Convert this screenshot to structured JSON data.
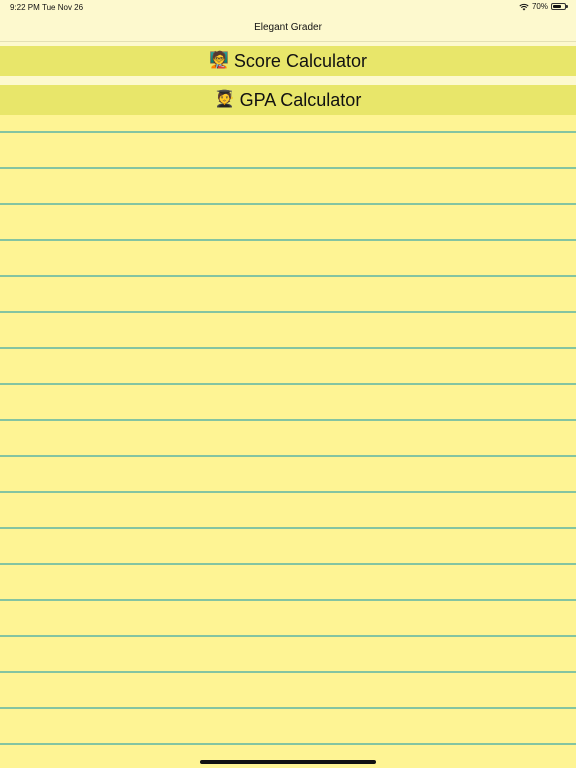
{
  "status_bar": {
    "time": "9:22 PM",
    "date": "Tue Nov 26",
    "battery_label": "70%",
    "battery_level": 0.7,
    "wifi_icon": "wifi-icon",
    "battery_icon": "battery-icon"
  },
  "nav": {
    "title": "Elegant Grader"
  },
  "menu": {
    "score": {
      "icon": "🧑‍🏫",
      "label": "Score Calculator"
    },
    "gpa": {
      "icon": "🧑‍🎓",
      "label": "GPA Calculator"
    }
  },
  "colors": {
    "background": "#fdf9ce",
    "button": "#e8e66a",
    "paper": "#fef494",
    "rule_line": "#84c4a1"
  }
}
